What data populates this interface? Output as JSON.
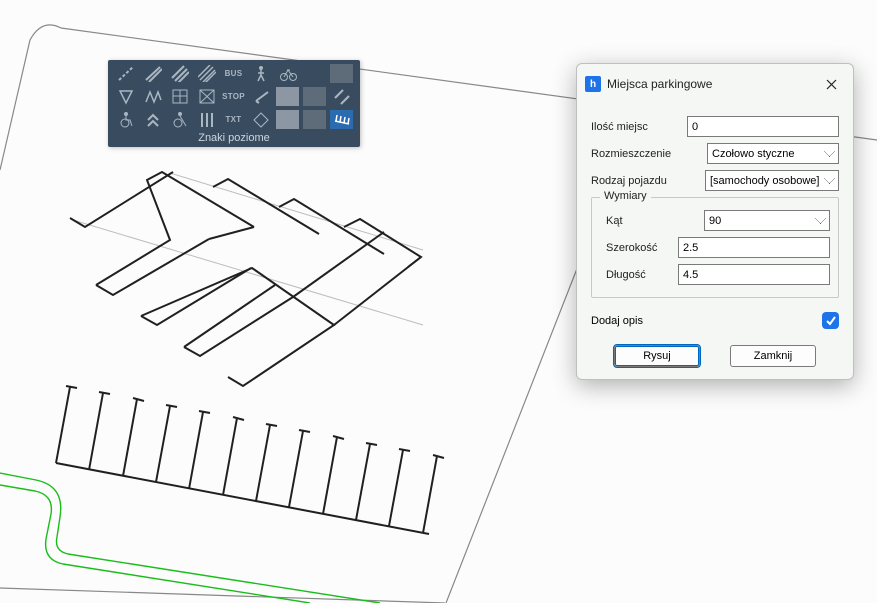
{
  "toolbar": {
    "title": "Znaki poziome",
    "rows": [
      [
        "diagonal-lines",
        "diagonal-stripe-a",
        "diagonal-stripe-b",
        "diagonal-stripe-c",
        "bus",
        "pedestrian",
        "bicycle",
        "spacer",
        "swatch-a"
      ],
      [
        "yield-triangle",
        "zigzag",
        "grid",
        "crossbox",
        "stop",
        "arrow-left",
        "swatch-light",
        "swatch-dark",
        "diag-double"
      ],
      [
        "wheelchair",
        "chevrons-up",
        "accessibility",
        "stripes-vert",
        "txt",
        "diamond",
        "swatch-light2",
        "swatch-dark2",
        "parking-lines"
      ]
    ]
  },
  "dialog": {
    "title": "Miejsca parkingowe",
    "fields": {
      "count_label": "Ilość miejsc",
      "count_value": "0",
      "layout_label": "Rozmieszczenie",
      "layout_value": "Czołowo styczne",
      "vehicle_label": "Rodzaj pojazdu",
      "vehicle_value": "[samochody osobowe]",
      "group_title": "Wymiary",
      "angle_label": "Kąt",
      "angle_value": "90",
      "width_label": "Szerokość",
      "width_value": "2.5",
      "length_label": "Długość",
      "length_value": "4.5",
      "add_desc_label": "Dodaj opis"
    },
    "buttons": {
      "draw": "Rysuj",
      "close": "Zamknij"
    }
  }
}
